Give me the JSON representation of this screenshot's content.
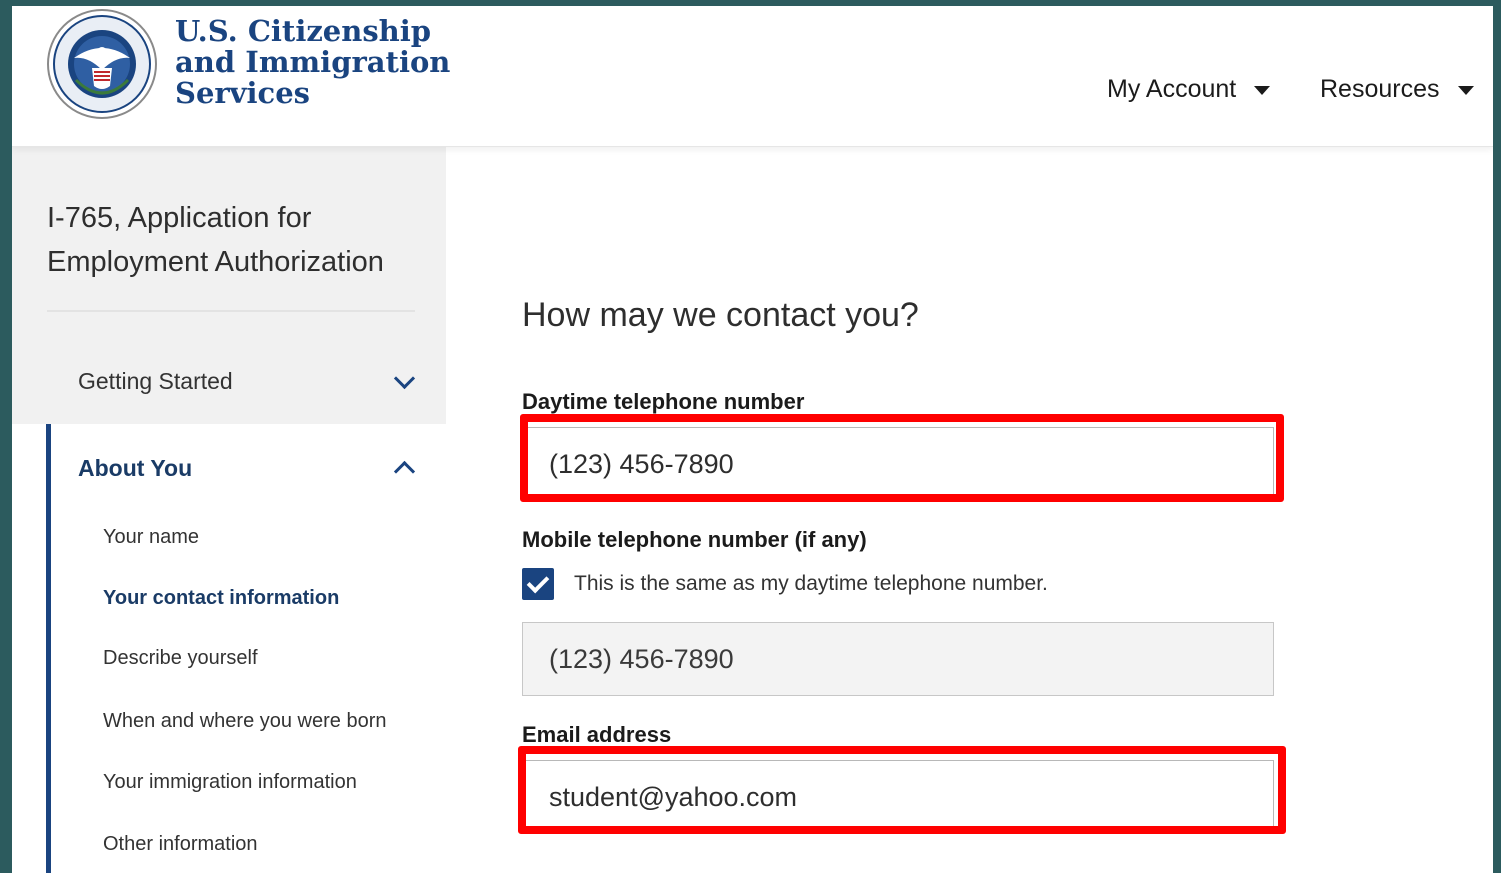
{
  "header": {
    "agency_line1": "U.S. Citizenship",
    "agency_line2": "and Immigration",
    "agency_line3": "Services",
    "seal_icon": "dhs-seal-icon",
    "nav": {
      "my_account": "My Account",
      "resources": "Resources"
    }
  },
  "sidebar": {
    "form_title": "I-765, Application for Employment Authorization",
    "sections": [
      {
        "label": "Getting Started",
        "state": "collapsed"
      },
      {
        "label": "About You",
        "state": "expanded"
      }
    ],
    "about_you_items": [
      "Your name",
      "Your contact information",
      "Describe yourself",
      "When and where you were born",
      "Your immigration information",
      "Other information"
    ],
    "current_item": "Your contact information"
  },
  "main": {
    "heading": "How may we contact you?",
    "daytime_label": "Daytime telephone number",
    "daytime_value": "(123) 456-7890",
    "mobile_label": "Mobile telephone number (if any)",
    "same_as_daytime_label": "This is the same as my daytime telephone number.",
    "same_as_daytime_checked": true,
    "mobile_value": "(123) 456-7890",
    "email_label": "Email address",
    "email_value": "student@yahoo.com"
  },
  "colors": {
    "brand_blue": "#1a4480",
    "highlight_red": "#ff0000",
    "backdrop": "#2c5b5e"
  }
}
